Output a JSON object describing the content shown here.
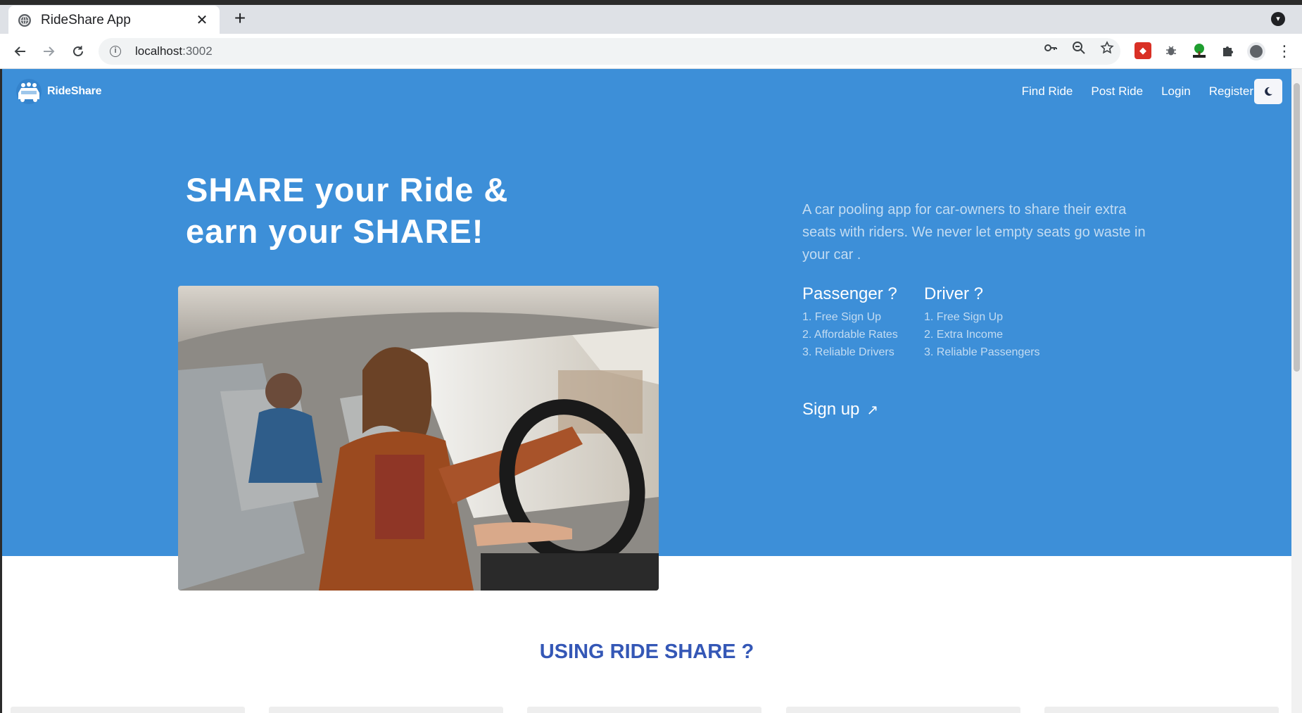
{
  "browser": {
    "tab_title": "RideShare App",
    "tab_close": "✕",
    "new_tab": "+",
    "url_host": "localhost",
    "url_port": ":3002"
  },
  "app": {
    "brand": "RideShare",
    "nav": {
      "find_ride": "Find Ride",
      "post_ride": "Post Ride",
      "login": "Login",
      "register": "Register"
    },
    "theme_icon": "moon-icon"
  },
  "hero": {
    "title_line1": "SHARE your Ride &",
    "title_line2": "earn your SHARE!",
    "description": "A car pooling app for car-owners to share their extra seats with riders. We never let empty seats go waste in your car .",
    "passenger": {
      "title": "Passenger ?",
      "items": [
        "1. Free Sign Up",
        "2. Affordable Rates",
        "3. Reliable Drivers"
      ]
    },
    "driver": {
      "title": "Driver ?",
      "items": [
        "1. Free Sign Up",
        "2. Extra Income",
        "3. Reliable Passengers"
      ]
    },
    "signup": "Sign up",
    "signup_arrow": "↗"
  },
  "section": {
    "title": "USING RIDE SHARE ?"
  },
  "colors": {
    "hero_bg": "#3d8fd8",
    "section_title": "#3457b6"
  }
}
